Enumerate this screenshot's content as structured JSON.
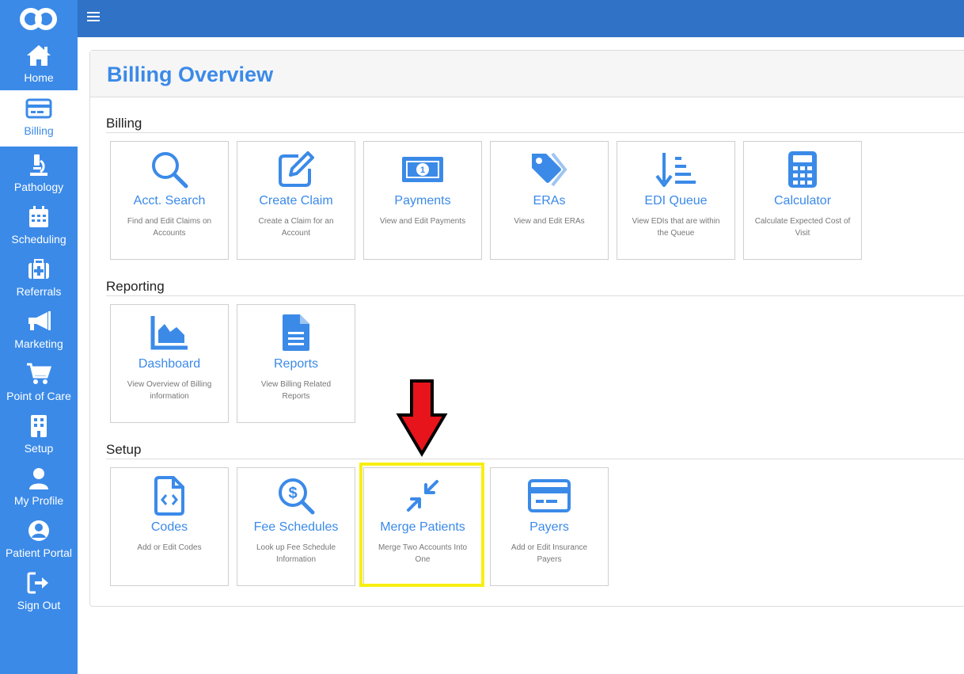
{
  "sidebar": {
    "items": [
      {
        "label": "Home",
        "icon": "home-icon"
      },
      {
        "label": "Billing",
        "icon": "credit-card-icon"
      },
      {
        "label": "Pathology",
        "icon": "microscope-icon"
      },
      {
        "label": "Scheduling",
        "icon": "calendar-icon"
      },
      {
        "label": "Referrals",
        "icon": "medical-kit-icon"
      },
      {
        "label": "Marketing",
        "icon": "megaphone-icon"
      },
      {
        "label": "Point of Care",
        "icon": "cart-icon"
      },
      {
        "label": "Setup",
        "icon": "building-icon"
      },
      {
        "label": "My Profile",
        "icon": "user-icon"
      },
      {
        "label": "Patient Portal",
        "icon": "user-circle-icon"
      },
      {
        "label": "Sign Out",
        "icon": "sign-out-icon"
      }
    ],
    "active": "Billing"
  },
  "page": {
    "title": "Billing Overview"
  },
  "sections": [
    {
      "title": "Billing",
      "cards": [
        {
          "title": "Acct. Search",
          "desc": "Find and Edit Claims on Accounts",
          "icon": "search-icon"
        },
        {
          "title": "Create Claim",
          "desc": "Create a Claim for an Account",
          "icon": "edit-icon"
        },
        {
          "title": "Payments",
          "desc": "View and Edit Payments",
          "icon": "money-bill-icon"
        },
        {
          "title": "ERAs",
          "desc": "View and Edit ERAs",
          "icon": "tags-icon"
        },
        {
          "title": "EDI Queue",
          "desc": "View EDIs that are within the Queue",
          "icon": "sort-amount-down-icon"
        },
        {
          "title": "Calculator",
          "desc": "Calculate Expected Cost of Visit",
          "icon": "calculator-icon"
        }
      ]
    },
    {
      "title": "Reporting",
      "cards": [
        {
          "title": "Dashboard",
          "desc": "View Overview of Billing information",
          "icon": "area-chart-icon"
        },
        {
          "title": "Reports",
          "desc": "View Billing Related Reports",
          "icon": "file-lines-icon"
        }
      ]
    },
    {
      "title": "Setup",
      "cards": [
        {
          "title": "Codes",
          "desc": "Add or Edit Codes",
          "icon": "file-code-icon"
        },
        {
          "title": "Fee Schedules",
          "desc": "Look up Fee Schedule Information",
          "icon": "search-dollar-icon"
        },
        {
          "title": "Merge Patients",
          "desc": "Merge Two Accounts Into One",
          "icon": "compress-arrows-icon"
        },
        {
          "title": "Payers",
          "desc": "Add or Edit Insurance Payers",
          "icon": "credit-card-icon"
        }
      ]
    }
  ],
  "colors": {
    "accent": "#3b8ae8",
    "topbar": "#3072c6",
    "highlight": "#f7ef12",
    "arrow": "#e8141b"
  }
}
